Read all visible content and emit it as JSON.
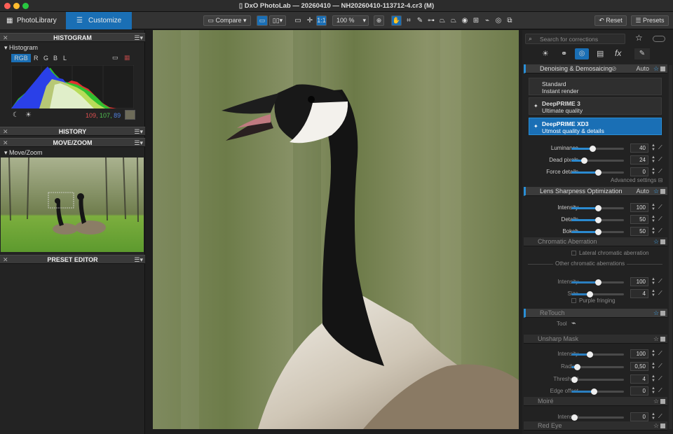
{
  "window": {
    "title": "DxO PhotoLab — 20260410 — NH20260410-113712-4.cr3 (M)"
  },
  "tabs": [
    {
      "label": "PhotoLibrary"
    },
    {
      "label": "Customize"
    }
  ],
  "toolbar": {
    "compare_label": "Compare",
    "zoom_value": "100 %",
    "one_to_one": "1:1",
    "reset_label": "Reset",
    "presets_label": "Presets"
  },
  "left": {
    "histogram_title": "HISTOGRAM",
    "histogram_sub": "Histogram",
    "channels": [
      "RGB",
      "R",
      "G",
      "B",
      "L"
    ],
    "rgb_r": "109,",
    "rgb_g": "107,",
    "rgb_b": "89",
    "history_title": "HISTORY",
    "movezoom_title": "MOVE/ZOOM",
    "movezoom_sub": "Move/Zoom",
    "preset_title": "PRESET EDITOR"
  },
  "right": {
    "search_placeholder": "Search for corrections",
    "denoise": {
      "title": "Denoising & Demosaicing",
      "auto": "Auto",
      "options": [
        {
          "name": "Standard",
          "desc": "Instant render"
        },
        {
          "name": "DeepPRIME 3",
          "desc": "Ultimate quality"
        },
        {
          "name": "DeepPRIME XD3",
          "desc": "Utmost quality & details"
        }
      ],
      "sliders": [
        {
          "label": "Luminance",
          "value": "40",
          "frac": 0.4
        },
        {
          "label": "Dead pixels",
          "value": "24",
          "frac": 0.24
        },
        {
          "label": "Force details",
          "value": "0",
          "frac": 0.5
        }
      ],
      "advanced": "Advanced settings"
    },
    "lens": {
      "title": "Lens Sharpness Optimization",
      "auto": "Auto",
      "sliders": [
        {
          "label": "Intensity",
          "value": "100",
          "frac": 0.5
        },
        {
          "label": "Details",
          "value": "50",
          "frac": 0.5
        },
        {
          "label": "Bokeh",
          "value": "50",
          "frac": 0.5
        }
      ]
    },
    "chroma": {
      "title": "Chromatic Aberration",
      "lateral": "Lateral chromatic aberration",
      "other": "Other chromatic aberrations",
      "sliders": [
        {
          "label": "Intensity",
          "value": "100",
          "frac": 0.5
        },
        {
          "label": "Size",
          "value": "4",
          "frac": 0.35
        }
      ],
      "purple": "Purple fringing"
    },
    "retouch": {
      "title": "ReTouch",
      "tool_label": "Tool"
    },
    "unsharp": {
      "title": "Unsharp Mask",
      "sliders": [
        {
          "label": "Intensity",
          "value": "100",
          "frac": 0.35
        },
        {
          "label": "Radius",
          "value": "0,50",
          "frac": 0.1
        },
        {
          "label": "Threshold",
          "value": "4",
          "frac": 0.05
        },
        {
          "label": "Edge offset",
          "value": "0",
          "frac": 0.42
        }
      ]
    },
    "moire": {
      "title": "Moiré",
      "sliders": [
        {
          "label": "Intensity",
          "value": "0",
          "frac": 0.05
        }
      ]
    },
    "redeye": {
      "title": "Red Eye"
    }
  },
  "colors": {
    "accent": "#2a8fd6",
    "selected": "#1a6fb5"
  }
}
